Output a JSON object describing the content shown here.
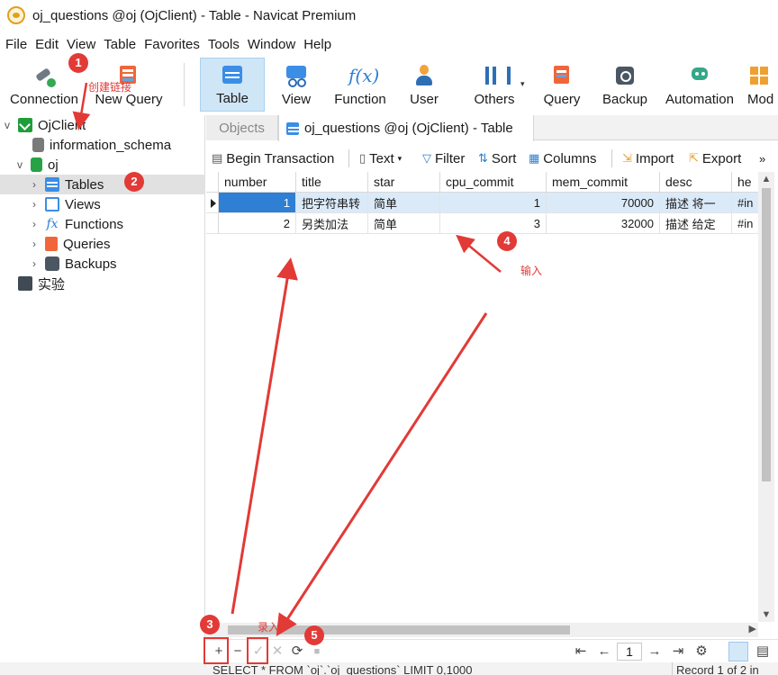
{
  "window": {
    "title": "oj_questions @oj (OjClient) - Table - Navicat Premium",
    "icon": "navicat-icon"
  },
  "menu": [
    "File",
    "Edit",
    "View",
    "Table",
    "Favorites",
    "Tools",
    "Window",
    "Help"
  ],
  "toolbar": {
    "connection": "Connection",
    "new_query": "New Query",
    "table": "Table",
    "view": "View",
    "function": "Function",
    "function_glyph": "f(x)",
    "user": "User",
    "others": "Others",
    "query": "Query",
    "backup": "Backup",
    "automation": "Automation",
    "model": "Mod"
  },
  "tree": {
    "connection": "OjClient",
    "information_schema": "information_schema",
    "db": "oj",
    "tables": "Tables",
    "views": "Views",
    "functions": "Functions",
    "queries": "Queries",
    "backups": "Backups",
    "other_connection": "实验"
  },
  "tabs": {
    "objects": "Objects",
    "active": "oj_questions @oj (OjClient) - Table"
  },
  "obj_toolbar": {
    "begin_transaction": "Begin Transaction",
    "text": "Text",
    "filter": "Filter",
    "sort": "Sort",
    "columns": "Columns",
    "import": "Import",
    "export": "Export"
  },
  "grid": {
    "columns": [
      "number",
      "title",
      "star",
      "cpu_commit",
      "mem_commit",
      "desc",
      "he"
    ],
    "rows": [
      [
        "1",
        "把字符串转",
        "简单",
        "1",
        "70000",
        "描述   将一",
        "#in"
      ],
      [
        "2",
        "另类加法",
        "简单",
        "3",
        "32000",
        "描述   给定",
        "#in"
      ]
    ]
  },
  "bottom_nav": {
    "add": "+",
    "delete": "−",
    "apply": "✓",
    "cancel": "✕",
    "refresh": "⟳",
    "stop": "■",
    "first": "⇤",
    "prev": "←",
    "page": "1",
    "next": "→",
    "last": "⇥",
    "settings": "⚙"
  },
  "status": {
    "sql": "SELECT * FROM `oj`.`oj_questions` LIMIT 0,1000",
    "record": "Record 1 of 2 in"
  },
  "annotations": {
    "b1": "1",
    "b2": "2",
    "b3": "3",
    "b4": "4",
    "b5": "5",
    "create_link": "创建链接",
    "input": "输入",
    "enter": "录入"
  },
  "colors": {
    "accent": "#2f7fd4",
    "annotation": "#e23a36",
    "selected_row": "#dbeaf8"
  }
}
